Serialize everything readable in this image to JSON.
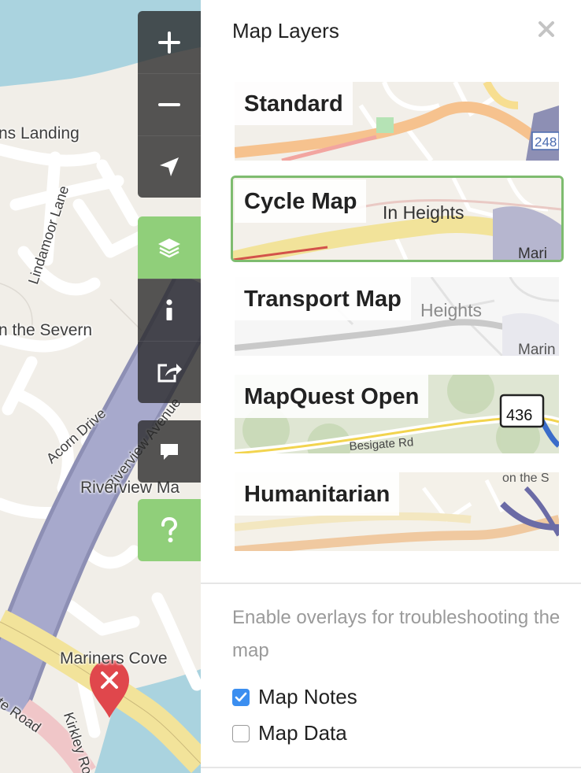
{
  "panel": {
    "title": "Map Layers",
    "close_icon": "close-icon"
  },
  "layers": [
    {
      "name": "Standard",
      "active": false
    },
    {
      "name": "Cycle Map",
      "active": true
    },
    {
      "name": "Transport Map",
      "active": false
    },
    {
      "name": "MapQuest Open",
      "active": false
    },
    {
      "name": "Humanitarian",
      "active": false
    }
  ],
  "layer_thumb_labels": {
    "standard_shield": "248",
    "cycle_place": "In Heights",
    "cycle_place_2": "Mari",
    "transport_place": "Heights",
    "transport_place_2": "Marin",
    "mapquest_shield": "436",
    "mapquest_road": "Besigate Rd",
    "humanitarian_place": "on the S"
  },
  "overlays": {
    "hint": "Enable overlays for troubleshooting the map",
    "items": [
      {
        "label": "Map Notes",
        "checked": true
      },
      {
        "label": "Map Data",
        "checked": false
      }
    ]
  },
  "controls": [
    {
      "icon": "zoom-in-icon"
    },
    {
      "icon": "zoom-out-icon"
    },
    {
      "icon": "locate-arrow-icon"
    },
    {
      "icon": "layers-icon"
    },
    {
      "icon": "info-icon"
    },
    {
      "icon": "share-icon"
    },
    {
      "icon": "note-comment-icon"
    },
    {
      "icon": "help-question-icon"
    }
  ],
  "map_labels": {
    "landing": "ns Landing",
    "lindamoor": "Lindamoor Lane",
    "severn": "n the Severn",
    "acorn": "Acorn Drive",
    "riverview_ave": "Riverview Avenue",
    "riverview_ma": "Riverview Ma",
    "mariners": "Mariners Cove",
    "kirkley": "Kirkley Road",
    "state_road": "te Road"
  },
  "colors": {
    "accent_green": "#7ebc6f",
    "control_green": "#90cf7a",
    "checkbox_blue": "#3b8ef0",
    "map_land": "#f2efe9",
    "map_water": "#aad3df"
  }
}
